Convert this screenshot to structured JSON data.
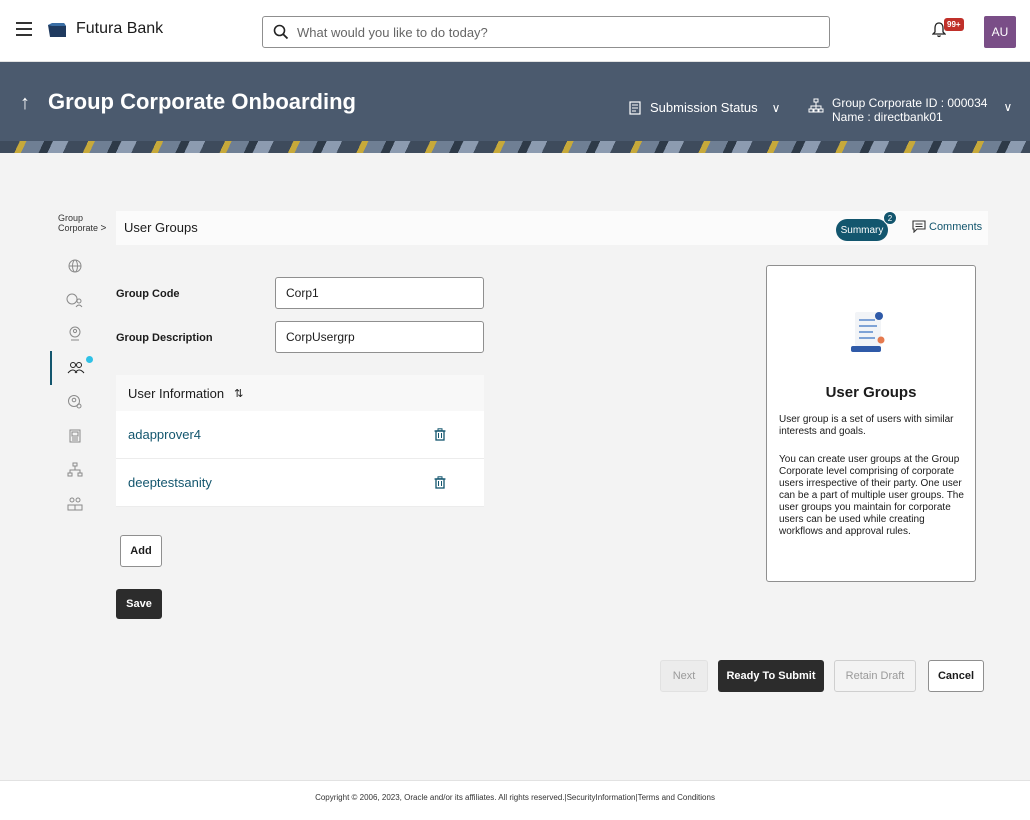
{
  "header": {
    "brand": "Futura Bank",
    "search_placeholder": "What would you like to do today?",
    "notification_badge": "99+",
    "avatar_initials": "AU"
  },
  "banner": {
    "title": "Group Corporate Onboarding",
    "submission_status": "Submission Status",
    "group_corporate_id": "Group Corporate ID : 000034",
    "group_corporate_name": "Name : directbank01"
  },
  "breadcrumb": {
    "line1": "Group",
    "line2": "Corporate",
    "separator": ">"
  },
  "section": {
    "title": "User Groups",
    "summary_label": "Summary",
    "summary_count": "2",
    "comments_label": "Comments"
  },
  "side_nav": [
    {
      "icon": "globe-icon",
      "active": false
    },
    {
      "icon": "global-people-icon",
      "active": false
    },
    {
      "icon": "user-location-icon",
      "active": false
    },
    {
      "icon": "user-groups-icon",
      "active": true
    },
    {
      "icon": "user-key-icon",
      "active": false
    },
    {
      "icon": "documents-icon",
      "active": false
    },
    {
      "icon": "hierarchy-icon",
      "active": false
    },
    {
      "icon": "puzzle-people-icon",
      "active": false
    }
  ],
  "form": {
    "group_code_label": "Group Code",
    "group_code_value": "Corp1",
    "group_description_label": "Group Description",
    "group_description_value": "CorpUsergrp"
  },
  "user_table": {
    "header": "User Information",
    "rows": [
      "adapprover4",
      "deeptestsanity"
    ]
  },
  "buttons": {
    "add": "Add",
    "save": "Save",
    "next": "Next",
    "ready_to_submit": "Ready To Submit",
    "retain_draft": "Retain Draft",
    "cancel": "Cancel"
  },
  "help": {
    "title": "User Groups",
    "para1": "User group is a set of users with similar interests and goals.",
    "para2": "You can create user groups at the Group Corporate level comprising of corporate users irrespective of their party. One user can be a part of multiple user groups. The user groups you maintain for corporate users can be used while creating workflows and approval rules."
  },
  "footer": {
    "text": "Copyright © 2006, 2023, Oracle and/or its affiliates. All rights reserved.|SecurityInformation|Terms and Conditions"
  },
  "colors": {
    "accent": "#13566e",
    "banner": "#4b5a6e",
    "dark_button": "#2c2c2c",
    "avatar": "#7a4e87",
    "badge": "#c0302a",
    "dot": "#2fc1e6"
  }
}
